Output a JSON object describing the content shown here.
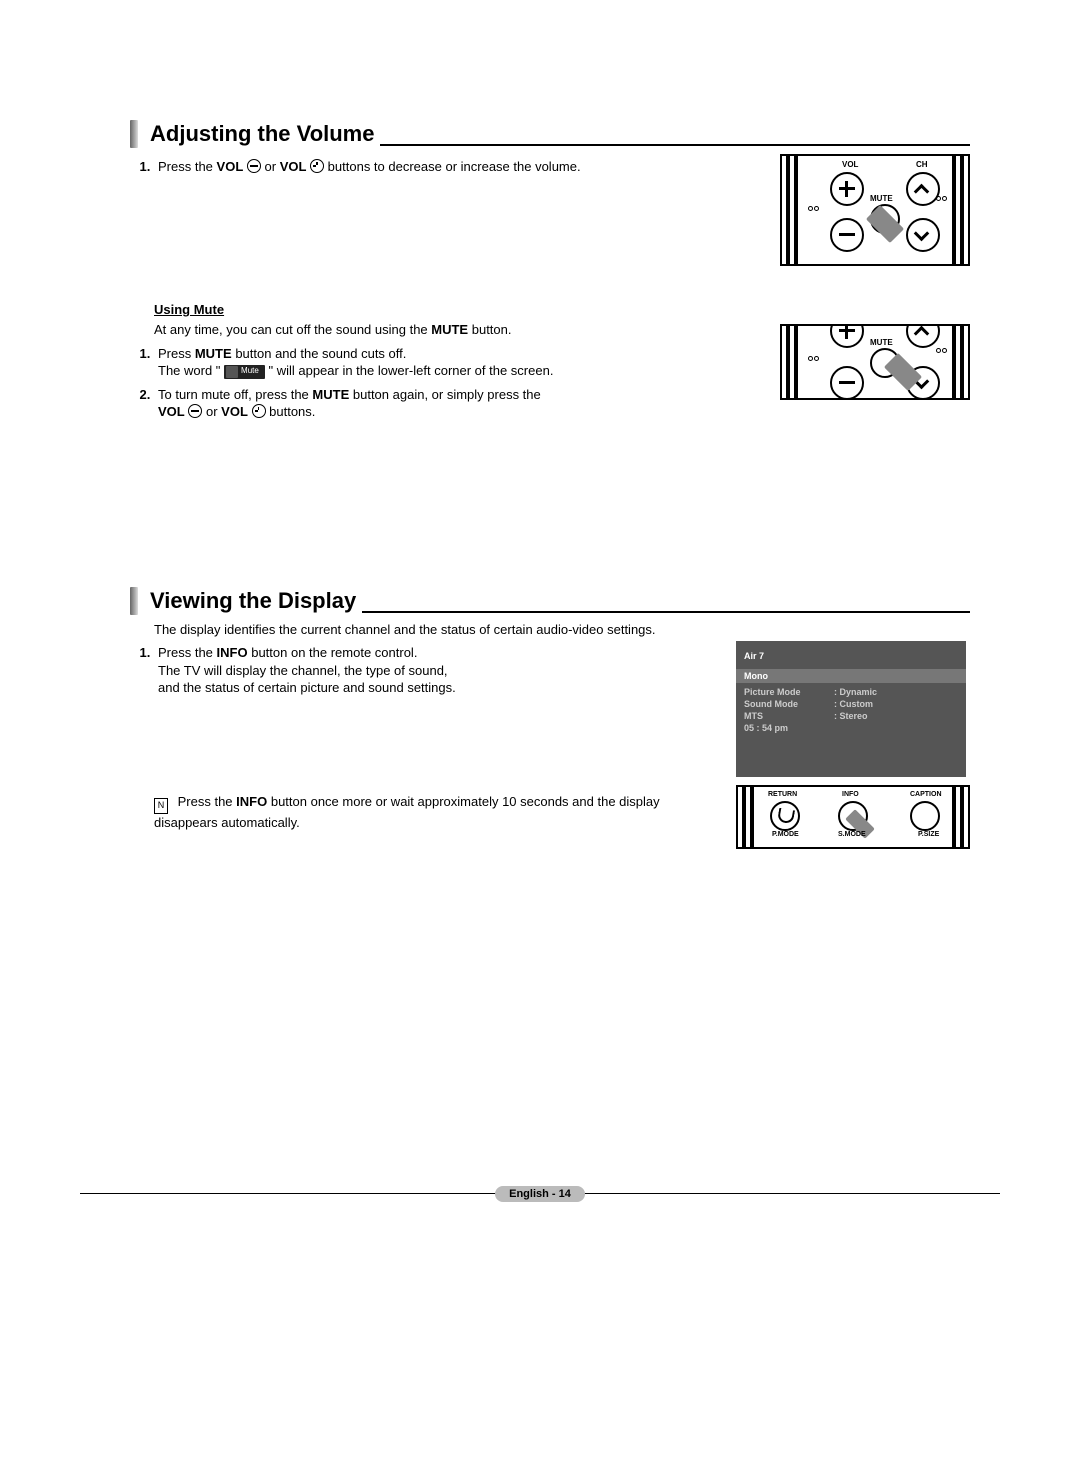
{
  "sections": {
    "volume": {
      "title": "Adjusting the Volume",
      "step1_a": "Press the ",
      "step1_vol": "VOL",
      "step1_b": " or ",
      "step1_c": " buttons to decrease or increase the volume.",
      "remote_labels": {
        "vol": "VOL",
        "ch": "CH",
        "mute": "MUTE"
      },
      "mute": {
        "heading": "Using Mute",
        "intro_a": "At any time, you can cut off the sound using the ",
        "intro_mute": "MUTE",
        "intro_b": " button.",
        "s1_a": "Press ",
        "s1_mute": "MUTE",
        "s1_b": " button and the sound cuts off.",
        "s1_line2_a": "The word \"",
        "mute_pill": "Mute",
        "s1_line2_b": "\" will appear in the lower-left corner of the screen.",
        "s2_a": "To turn mute off, press the ",
        "s2_mute": "MUTE",
        "s2_b": " button again, or simply press the",
        "s2_line2_a": "VOL",
        "s2_line2_mid": " or ",
        "s2_line2_c": " buttons."
      }
    },
    "display": {
      "title": "Viewing the Display",
      "intro": "The display identifies the current channel and the status of certain audio-video settings.",
      "s1_a": "Press the ",
      "s1_info": "INFO",
      "s1_b": " button on the remote control.",
      "s1_line2": "The TV will display the channel, the type of sound,",
      "s1_line3": "and the status of certain picture and sound settings.",
      "note_a": "Press the ",
      "note_info": "INFO",
      "note_b": " button once more or wait approximately 10 seconds and the display disappears automatically.",
      "osd": {
        "channel": "Air  7",
        "sound": "Mono",
        "rows": [
          {
            "k": "Picture Mode",
            "v": "Dynamic"
          },
          {
            "k": "Sound Mode",
            "v": "Custom"
          },
          {
            "k": "MTS",
            "v": "Stereo"
          }
        ],
        "time": "05 : 54 pm"
      },
      "remote": {
        "return": "RETURN",
        "info": "INFO",
        "caption": "CAPTION",
        "pmode": "P.MODE",
        "smode": "S.MODE",
        "psize": "P.SIZE"
      }
    }
  },
  "footer": "English - 14"
}
